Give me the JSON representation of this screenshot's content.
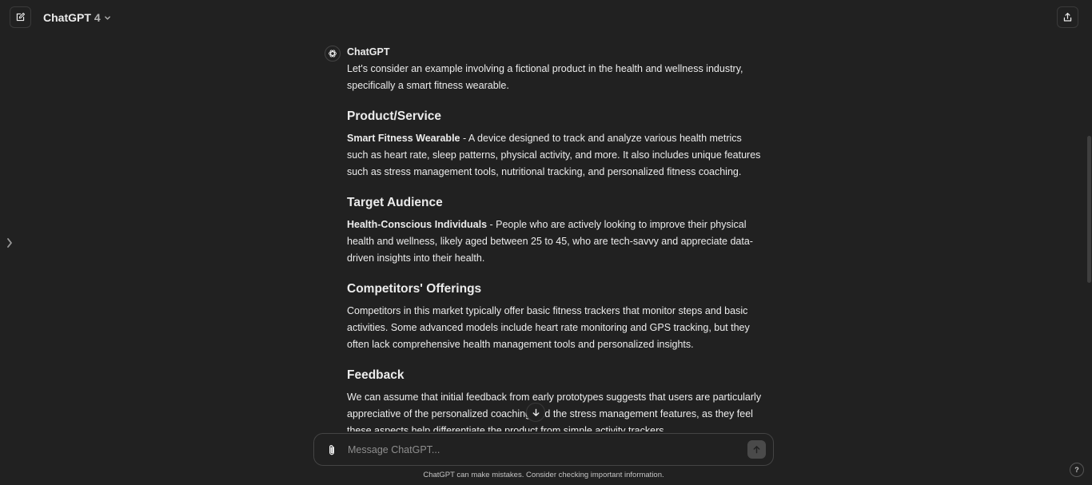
{
  "header": {
    "model_name": "ChatGPT",
    "model_version": "4"
  },
  "message": {
    "author": "ChatGPT",
    "intro": "Let's consider an example involving a fictional product in the health and wellness industry, specifically a smart fitness wearable.",
    "sections": [
      {
        "heading": "Product/Service",
        "bold_lead": "Smart Fitness Wearable",
        "text": " - A device designed to track and analyze various health metrics such as heart rate, sleep patterns, physical activity, and more. It also includes unique features such as stress management tools, nutritional tracking, and personalized fitness coaching."
      },
      {
        "heading": "Target Audience",
        "bold_lead": "Health-Conscious Individuals",
        "text": " - People who are actively looking to improve their physical health and wellness, likely aged between 25 to 45, who are tech-savvy and appreciate data-driven insights into their health."
      },
      {
        "heading": "Competitors' Offerings",
        "bold_lead": "",
        "text": "Competitors in this market typically offer basic fitness trackers that monitor steps and basic activities. Some advanced models include heart rate monitoring and GPS tracking, but they often lack comprehensive health management tools and personalized insights."
      },
      {
        "heading": "Feedback",
        "bold_lead": "",
        "text": "We can assume that initial feedback from early prototypes suggests that users are particularly appreciative of the personalized coaching and the stress management features, as they feel these aspects help differentiate the product from simple activity trackers."
      }
    ]
  },
  "composer": {
    "placeholder": "Message ChatGPT..."
  },
  "footer": {
    "disclaimer": "ChatGPT can make mistakes. Consider checking important information.",
    "help_label": "?"
  },
  "icons": {
    "new_chat": "edit-icon",
    "chevron": "chevron-down-icon",
    "share": "share-icon",
    "sidebar_toggle": "chevron-right-icon",
    "avatar": "openai-logo-icon",
    "scroll_down": "arrow-down-icon",
    "attach": "paperclip-icon",
    "send": "arrow-up-icon"
  }
}
